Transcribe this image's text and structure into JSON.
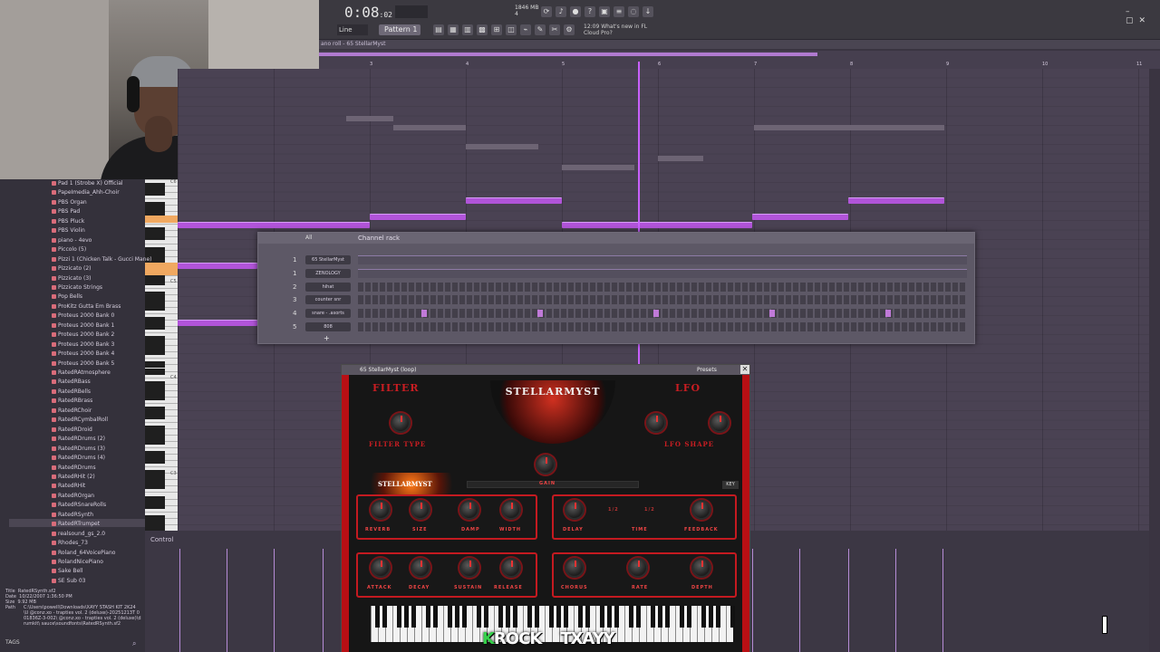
{
  "toolbar": {
    "time": "0:08",
    "time_sub": ":02",
    "bpm_top": "1846 MB",
    "bpm_bottom": "4",
    "line_mode": "Line",
    "pattern": "Pattern 1",
    "news_line1": "12:09  What's new in FL",
    "news_line2": "Cloud Pro?"
  },
  "piano_roll": {
    "title": "ano roll - 65 StellarMyst",
    "bar_numbers": [
      "3",
      "4",
      "5",
      "6",
      "7",
      "8",
      "9",
      "10",
      "11"
    ]
  },
  "browser": {
    "items": [
      "Pad 1 (Strobe X) Official",
      "PapeImedia_Ahh-Choir",
      "PBS Organ",
      "PBS Pad",
      "PBS Pluck",
      "PBS Violin",
      "piano - 4evo",
      "Piccolo (5)",
      "Pizzi 1 (Chicken Talk - Gucci Mane)",
      "Pizzicato (2)",
      "Pizzicato (3)",
      "Pizzicato Strings",
      "Pop Bells",
      "ProKitz Gutta Em Brass",
      "Proteus 2000 Bank 0",
      "Proteus 2000 Bank 1",
      "Proteus 2000 Bank 2",
      "Proteus 2000 Bank 3",
      "Proteus 2000 Bank 4",
      "Proteus 2000 Bank 5",
      "RatedRAtmosphere",
      "RatedRBass",
      "RatedRBells",
      "RatedRBrass",
      "RatedRChoir",
      "RatedRCymbalRoll",
      "RatedRDroid",
      "RatedRDrums (2)",
      "RatedRDrums (3)",
      "RatedRDrums (4)",
      "RatedRDrums",
      "RatedRHit (2)",
      "RatedRHit",
      "RatedROrgan",
      "RatedRSnareRolls",
      "RatedRSynth",
      "RatedRTrumpet",
      "realsound_gs_2.0",
      "Rhodes_73",
      "Roland_64VoicePiano",
      "RolandNicePiano",
      "Sake Bell",
      "SE Sub 03"
    ],
    "info_title_label": "Title",
    "info_title": "RatedRSynth.sf2",
    "info_date_label": "Date",
    "info_date": "10/22/2007 1:36:50 PM",
    "info_size_label": "Size",
    "info_size": "9.92 MB",
    "info_path_label": "Path",
    "info_path": "C:\\Users\\powell\\Downloads\\XAYY STASH KIT 2K24 \\U @conz.xo - trapties vol. 2 (deluxe)-20251213T 001836Z-3-002\\ @conz.xo - trapties vol. 2 (deluxe)\\drumkit\\ sauce\\soundfonts\\RatedRSynth.sf2",
    "tags": "TAGS"
  },
  "keys": {
    "octaves": [
      "C6",
      "C5",
      "C4",
      "C3"
    ]
  },
  "control": {
    "label": "Control"
  },
  "channel_rack": {
    "title": "Channel rack",
    "filter": "All",
    "channels": [
      {
        "num": "1",
        "name": "65 StellarMyst"
      },
      {
        "num": "1",
        "name": "ZENOLOGY"
      },
      {
        "num": "2",
        "name": "hihat"
      },
      {
        "num": "3",
        "name": "counter snr"
      },
      {
        "num": "4",
        "name": "snare - .asorts"
      },
      {
        "num": "5",
        "name": "808"
      }
    ]
  },
  "plugin": {
    "name": "65 StellarMyst (loop)",
    "presets": "Presets",
    "logo": "STELLARMYST",
    "filter_title": "FILTER",
    "lfo_title": "LFO",
    "filter_type": "FILTER TYPE",
    "lfo_shape": "LFO SHAPE",
    "gain": "GAIN",
    "key": "KEY",
    "panel_logo": "STELLARMYST",
    "fx_labels": [
      "REVERB",
      "SIZE",
      "DAMP",
      "WIDTH"
    ],
    "delay_labels": [
      "DELAY",
      "TIME",
      "FEEDBACK"
    ],
    "delay_values": [
      "1/2",
      "1/2"
    ],
    "env_labels": [
      "ATTACK",
      "DECAY",
      "SUSTAIN",
      "RELEASE"
    ],
    "chorus_labels": [
      "CHORUS",
      "RATE",
      "DEPTH"
    ]
  },
  "watermark": {
    "k": "K",
    "text": "ROCK",
    "suffix": "TXAYY"
  }
}
